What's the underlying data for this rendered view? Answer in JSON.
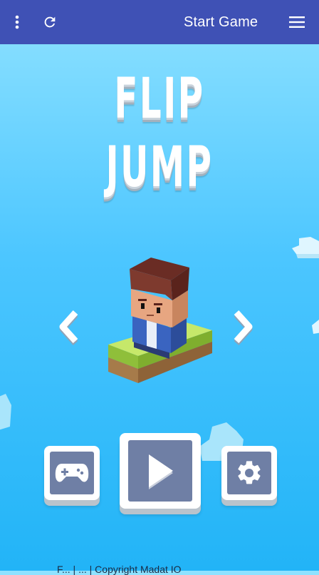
{
  "appbar": {
    "title": "Start Game",
    "icons": [
      "more-vert-icon",
      "refresh-icon",
      "hamburger-menu-icon"
    ],
    "background": "#3f51b5"
  },
  "game": {
    "title_line1": "FLIP",
    "title_line2": "JUMP"
  },
  "controls": {
    "prev_glyph": "‹",
    "next_glyph": "›",
    "buttons": [
      "gamepad-icon",
      "play-icon",
      "gear-icon"
    ]
  },
  "footer": {
    "text": "F... | ... | Copyright Madat IO"
  },
  "colors": {
    "sky_top": "#8fe2ff",
    "sky_bottom": "#22b4f7",
    "button_face": "#6f7fa5",
    "title": "#ffffff"
  }
}
